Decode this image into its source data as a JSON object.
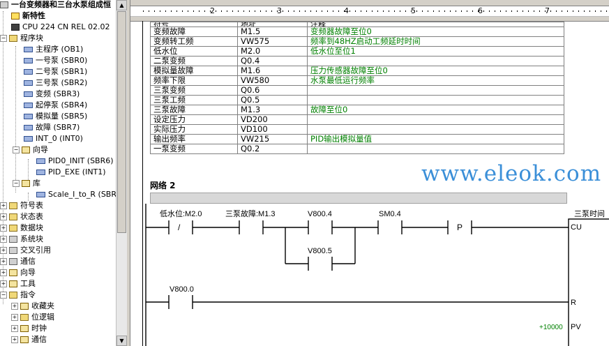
{
  "project_tree": {
    "root": "一台变频器和三台水泵组成恒",
    "items": [
      {
        "label": "新特性",
        "icon": "help-icon"
      },
      {
        "label": "CPU 224 CN REL 02.02",
        "icon": "cpu-icon"
      },
      {
        "label": "程序块",
        "icon": "folder-icon"
      },
      {
        "label": "主程序 (OB1)",
        "icon": "program-icon"
      },
      {
        "label": "一号泵 (SBR0)",
        "icon": "program-icon"
      },
      {
        "label": "二号泵 (SBR1)",
        "icon": "program-icon"
      },
      {
        "label": "三号泵 (SBR2)",
        "icon": "program-icon"
      },
      {
        "label": "变频 (SBR3)",
        "icon": "program-icon"
      },
      {
        "label": "起停泵 (SBR4)",
        "icon": "program-icon"
      },
      {
        "label": "模拟量 (SBR5)",
        "icon": "program-icon"
      },
      {
        "label": "故障 (SBR7)",
        "icon": "program-icon"
      },
      {
        "label": "INT_0 (INT0)",
        "icon": "program-icon"
      },
      {
        "label": "向导",
        "icon": "wizard-folder-icon"
      },
      {
        "label": "PID0_INIT (SBR6)",
        "icon": "program-icon"
      },
      {
        "label": "PID_EXE (INT1)",
        "icon": "program-icon"
      },
      {
        "label": "库",
        "icon": "library-folder-icon"
      },
      {
        "label": "Scale_I_to_R (SBR",
        "icon": "program-icon"
      },
      {
        "label": "符号表",
        "icon": "folder-icon"
      },
      {
        "label": "状态表",
        "icon": "folder-icon"
      },
      {
        "label": "数据块",
        "icon": "folder-icon"
      },
      {
        "label": "系统块",
        "icon": "system-icon"
      },
      {
        "label": "交叉引用",
        "icon": "cross-ref-icon"
      },
      {
        "label": "通信",
        "icon": "comm-icon"
      },
      {
        "label": "向导",
        "icon": "wizard-icon"
      },
      {
        "label": "工具",
        "icon": "tools-icon"
      },
      {
        "label": "指令",
        "icon": "instructions-icon"
      },
      {
        "label": "收藏夹",
        "icon": "favorites-icon"
      },
      {
        "label": "位逻辑",
        "icon": "folder-icon"
      },
      {
        "label": "时钟",
        "icon": "clock-icon"
      },
      {
        "label": "通信",
        "icon": "comm-icon"
      }
    ]
  },
  "ruler": {
    "numbers": [
      "2",
      "3",
      "4",
      "5",
      "6",
      "7"
    ]
  },
  "symbol_table": {
    "headers": [
      "符号",
      "地址",
      "注释"
    ],
    "rows": [
      [
        "变频故障",
        "M1.5",
        "变频器故障至位0"
      ],
      [
        "变频转工频",
        "VW575",
        "频率到48HZ启动工频延时时间"
      ],
      [
        "低水位",
        "M2.0",
        "低水位至位1"
      ],
      [
        "二泵变频",
        "Q0.4",
        ""
      ],
      [
        "模拟量故障",
        "M1.6",
        "压力传感器故障至位0"
      ],
      [
        "频率下限",
        "VW580",
        "水泵最低运行频率"
      ],
      [
        "三泵变频",
        "Q0.6",
        ""
      ],
      [
        "三泵工频",
        "Q0.5",
        ""
      ],
      [
        "三泵故障",
        "M1.3",
        "故障至位0"
      ],
      [
        "设定压力",
        "VD200",
        ""
      ],
      [
        "实际压力",
        "VD100",
        ""
      ],
      [
        "输出频率",
        "VW215",
        "PID输出模拟量值"
      ],
      [
        "一泵变频",
        "Q0.2",
        ""
      ]
    ]
  },
  "network": {
    "title": "网络 2",
    "contacts": {
      "c1": "低水位:M2.0",
      "c2": "三泵故障:M1.3",
      "c3": "V800.4",
      "c4": "SM0.4",
      "c5": "V800.5",
      "c6": "V800.0"
    },
    "not_symbol": "/",
    "p_symbol": "P",
    "counter": {
      "name": "三泵时间",
      "cu": "CU",
      "r": "R",
      "pv": "PV",
      "pv_value": "+10000"
    }
  },
  "watermark": "www.eleok.com"
}
